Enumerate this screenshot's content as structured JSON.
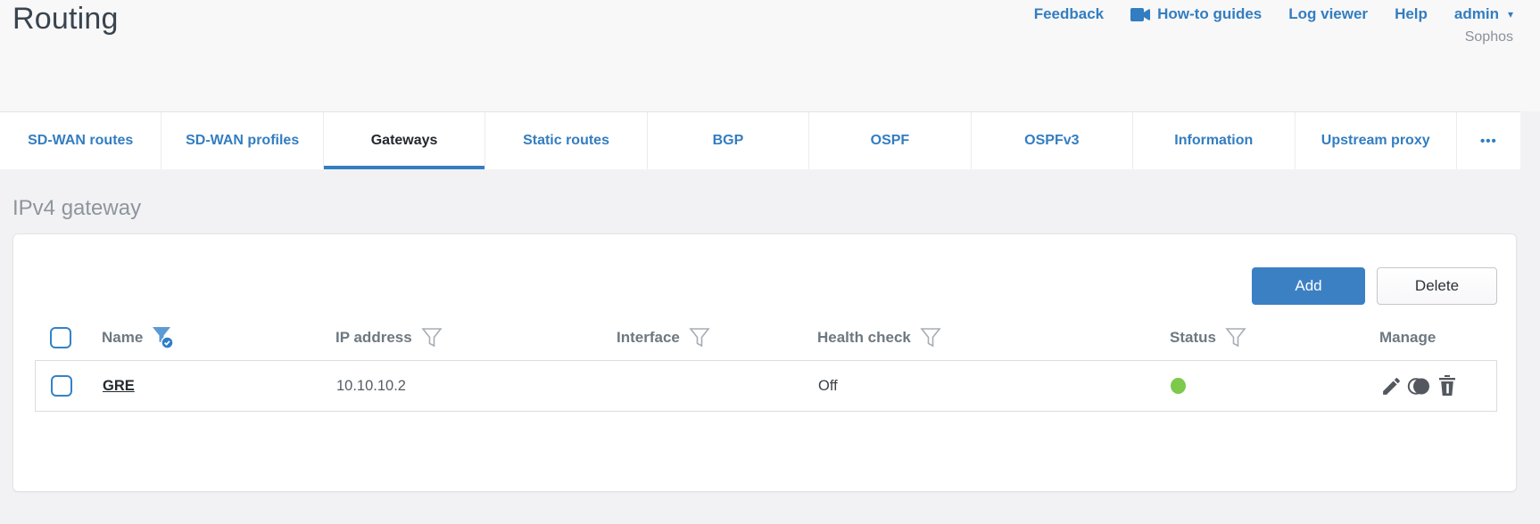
{
  "page": {
    "title": "Routing",
    "brand": "Sophos"
  },
  "colors": {
    "accent_blue": "#337dc1",
    "button_blue": "#3c80c4",
    "status_green": "#7cc94c",
    "icon_gray": "#53585e"
  },
  "top_nav": {
    "feedback": "Feedback",
    "howto": "How-to guides",
    "howto_icon": "video-camera",
    "log_viewer": "Log viewer",
    "help": "Help",
    "user": "admin",
    "caret": "▾"
  },
  "tabs": {
    "items": [
      {
        "label": "SD-WAN routes",
        "active": false
      },
      {
        "label": "SD-WAN profiles",
        "active": false
      },
      {
        "label": "Gateways",
        "active": true
      },
      {
        "label": "Static routes",
        "active": false
      },
      {
        "label": "BGP",
        "active": false
      },
      {
        "label": "OSPF",
        "active": false
      },
      {
        "label": "OSPFv3",
        "active": false
      },
      {
        "label": "Information",
        "active": false
      },
      {
        "label": "Upstream proxy",
        "active": false
      }
    ],
    "overflow": "•••"
  },
  "section": {
    "heading": "IPv4 gateway"
  },
  "toolbar": {
    "add": "Add",
    "delete": "Delete"
  },
  "table": {
    "columns": [
      {
        "label": "Name",
        "filter": "active"
      },
      {
        "label": "IP address",
        "filter": "inactive"
      },
      {
        "label": "Interface",
        "filter": "inactive"
      },
      {
        "label": "Health check",
        "filter": "inactive"
      },
      {
        "label": "Status",
        "filter": "inactive"
      },
      {
        "label": "Manage",
        "filter": "none"
      }
    ],
    "rows": [
      {
        "name": "GRE",
        "ip": "10.10.10.2",
        "interface": "",
        "health_check": "Off",
        "status": "up",
        "status_style": "background-color:#7cc94c",
        "manage_icons": [
          "edit",
          "clone",
          "delete"
        ]
      }
    ]
  }
}
